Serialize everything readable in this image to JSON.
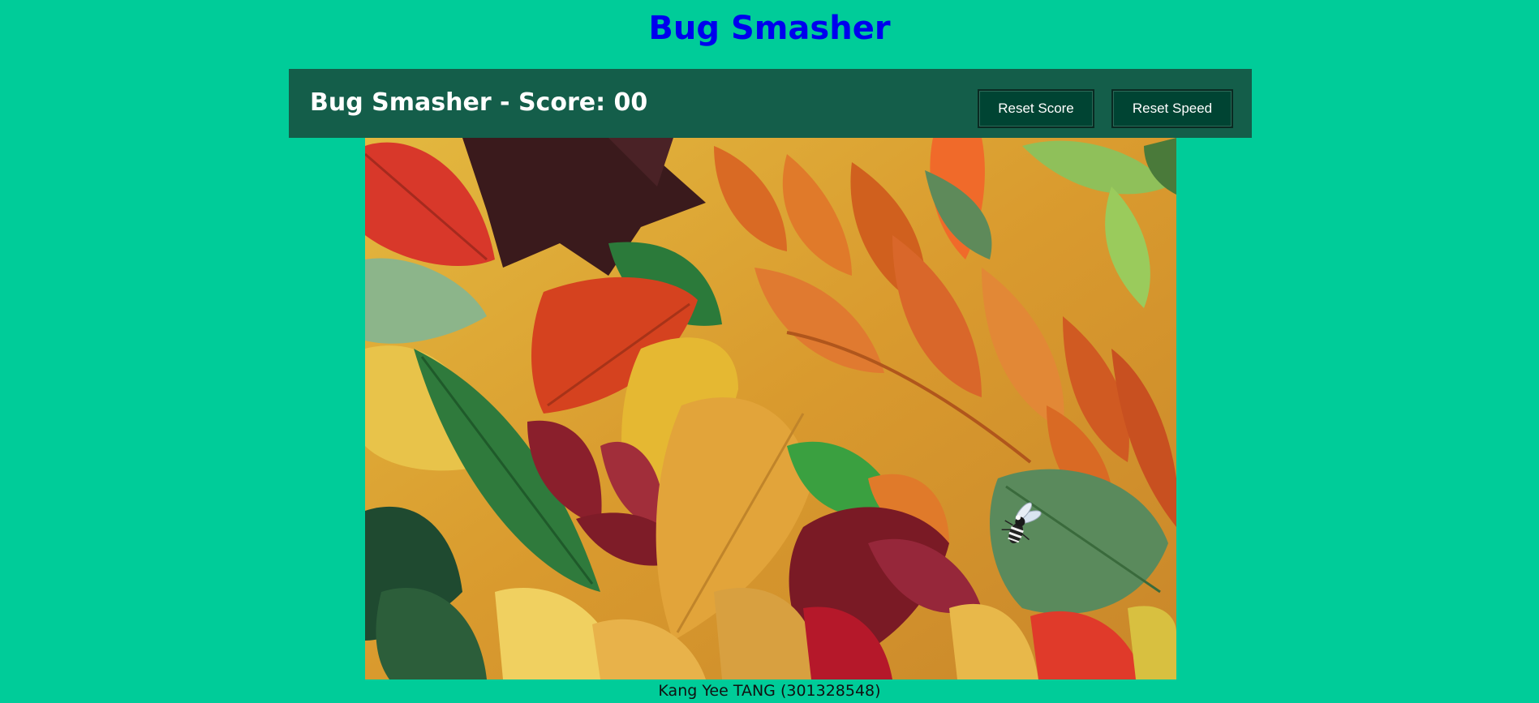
{
  "page": {
    "title": "Bug Smasher",
    "title_color": "#0000ee",
    "background_color": "#00cc99"
  },
  "header": {
    "score_text": "Bug Smasher - Score: 00",
    "score": 0,
    "bar_color": "#145e4a",
    "buttons": {
      "reset_score": "Reset Score",
      "reset_speed": "Reset Speed"
    },
    "button_color": "#004433"
  },
  "game": {
    "background_image": "autumn-leaves-background",
    "bug_icon": "fly-bug-icon"
  },
  "footer": {
    "credit": "Kang Yee TANG (301328548)"
  }
}
